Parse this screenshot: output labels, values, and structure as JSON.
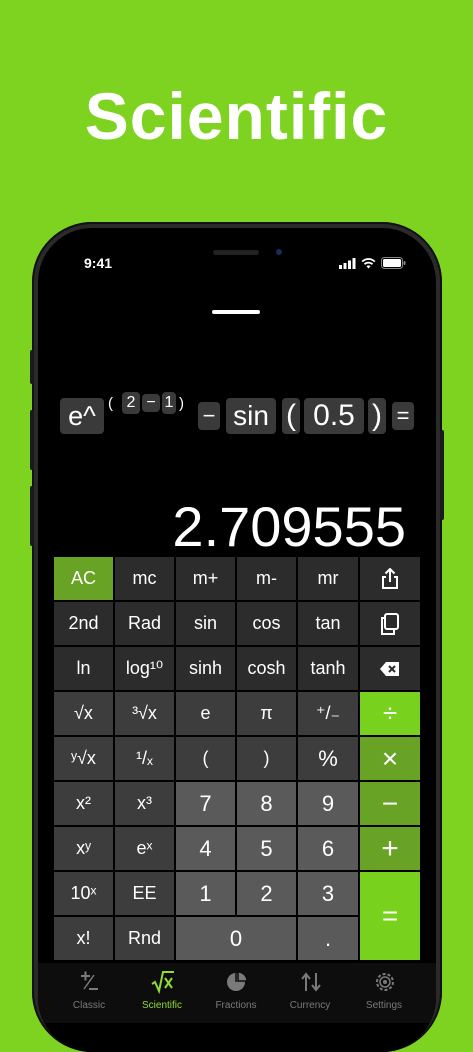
{
  "headline": "Scientific",
  "status": {
    "time": "9:41"
  },
  "expression": {
    "e_pow": "e^",
    "open1": "(",
    "two": "2",
    "minus1": "−",
    "one": "1",
    "close1": ")",
    "minus2": "−",
    "sin": "sin",
    "open2": "(",
    "val": "0.5",
    "close2": ")",
    "equals": "="
  },
  "result": "2.709555",
  "keys": {
    "ac": "AC",
    "mc": "mc",
    "mplus": "m+",
    "mminus": "m-",
    "mr": "mr",
    "second": "2nd",
    "rad": "Rad",
    "sin": "sin",
    "cos": "cos",
    "tan": "tan",
    "ln": "ln",
    "log10": "log¹⁰",
    "sinh": "sinh",
    "cosh": "cosh",
    "tanh": "tanh",
    "sqrt": "√x",
    "cbrt": "³√x",
    "e": "e",
    "pi": "π",
    "plusminus": "⁺/₋",
    "divide": "÷",
    "yroot": "ʸ√x",
    "recip": "¹/ₓ",
    "lparen": "(",
    "rparen": ")",
    "percent": "%",
    "multiply": "×",
    "sq": "x²",
    "cube": "x³",
    "n7": "7",
    "n8": "8",
    "n9": "9",
    "minus": "−",
    "xy": "xʸ",
    "ex": "eˣ",
    "n4": "4",
    "n5": "5",
    "n6": "6",
    "plus": "+",
    "tenx": "10ˣ",
    "ee": "EE",
    "n1": "1",
    "n2": "2",
    "n3": "3",
    "equals": "=",
    "fact": "x!",
    "rnd": "Rnd",
    "n0": "0",
    "dot": "."
  },
  "tabs": [
    {
      "label": "Classic"
    },
    {
      "label": "Scientific"
    },
    {
      "label": "Fractions"
    },
    {
      "label": "Currency"
    },
    {
      "label": "Settings"
    }
  ],
  "colors": {
    "background": "#7ed321",
    "accent": "#69a325",
    "operator": "#78d11c"
  }
}
